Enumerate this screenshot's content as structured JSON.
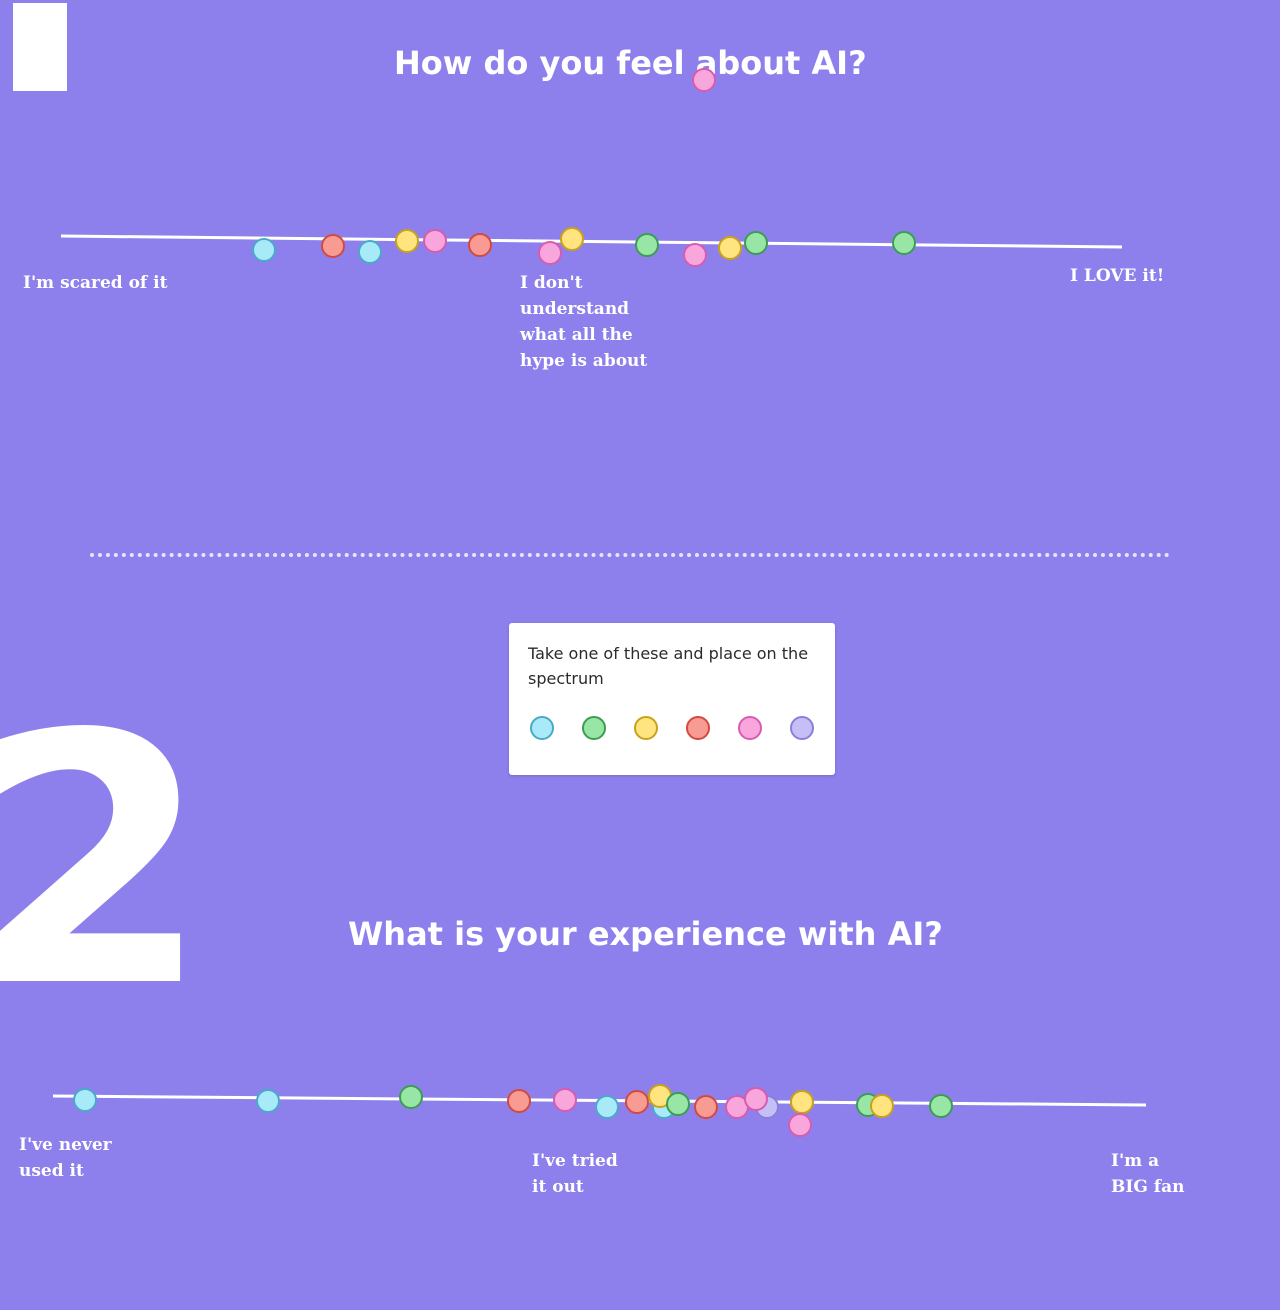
{
  "question1": {
    "title": "How do you feel about AI?",
    "labels": {
      "left": "I'm scared of it",
      "middle": "I don't understand what all the hype is about",
      "right": "I LOVE it!"
    }
  },
  "question2": {
    "title": "What is your experience with AI?",
    "labels": {
      "left": "I've never used it",
      "middle": "I've tried it out",
      "right": "I'm a BIG fan"
    }
  },
  "section_number": "2",
  "instruction_card": {
    "text": "Take one of these and place on the spectrum",
    "swatches": [
      "blue",
      "green",
      "yellow",
      "red",
      "pink",
      "purple"
    ]
  },
  "colors": {
    "board": "#8e80ec",
    "blue": "#a8eaf8",
    "green": "#98e6a6",
    "yellow": "#ffe47f",
    "red": "#f79b93",
    "pink": "#f9a6dc",
    "purple": "#c6bff7"
  }
}
